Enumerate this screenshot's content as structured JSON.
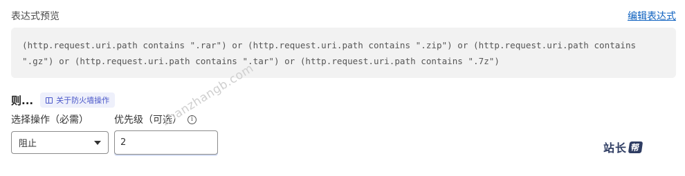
{
  "header": {
    "title": "表达式预览",
    "edit_link": "编辑表达式"
  },
  "expression": {
    "text": "(http.request.uri.path contains \".rar\") or (http.request.uri.path contains \".zip\") or (http.request.uri.path contains \".gz\") or (http.request.uri.path contains \".tar\") or (http.request.uri.path contains \".7z\")"
  },
  "then_section": {
    "label": "则...",
    "about_badge": "关于防火墙操作"
  },
  "action": {
    "label": "选择操作（必需）",
    "selected": "阻止"
  },
  "priority": {
    "label": "优先级（可选）",
    "info_glyph": "i",
    "value": "2"
  },
  "watermark": {
    "text": "zhanzhangb.com"
  },
  "logo": {
    "text": "站长",
    "mark": "帮"
  }
}
